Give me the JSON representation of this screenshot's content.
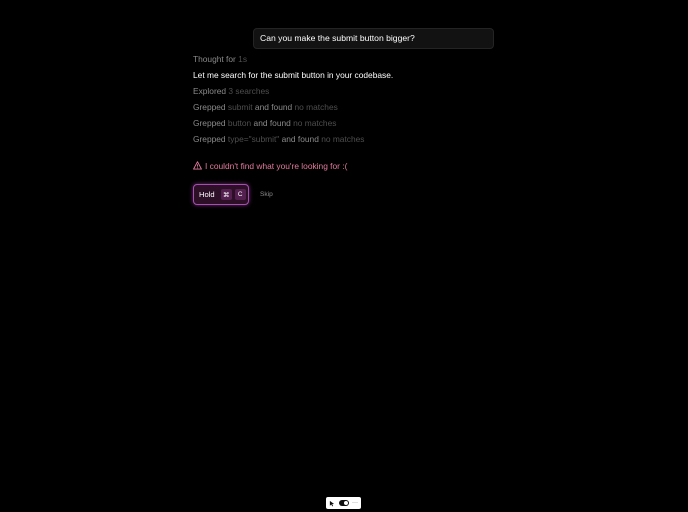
{
  "user_message": "Can you make the submit button bigger?",
  "assistant": {
    "thought": {
      "prefix": "Thought for",
      "duration": "1s"
    },
    "intro": "Let me search for the submit button in your codebase.",
    "explored": {
      "prefix": "Explored",
      "count": "3 searches"
    },
    "searches": [
      {
        "verb": "Grepped",
        "term": "submit",
        "middle": "and found",
        "result": "no matches"
      },
      {
        "verb": "Grepped",
        "term": "button",
        "middle": "and found",
        "result": "no matches"
      },
      {
        "verb": "Grepped",
        "term": "type=\"submit\"",
        "middle": "and found",
        "result": "no matches"
      }
    ],
    "warning": "I couldn't find what you're looking for :("
  },
  "actions": {
    "hold_label": "Hold",
    "key1": "⌘",
    "key2": "C",
    "skip_label": "Skip"
  },
  "toolbar": {
    "icons": [
      "cursor-icon",
      "toggle-switch-icon",
      "more-options-icon"
    ]
  },
  "colors": {
    "background": "#000000",
    "warning": "#e47a9d",
    "hold_border": "#a64fb1",
    "hold_bg": "#2d0f28"
  }
}
